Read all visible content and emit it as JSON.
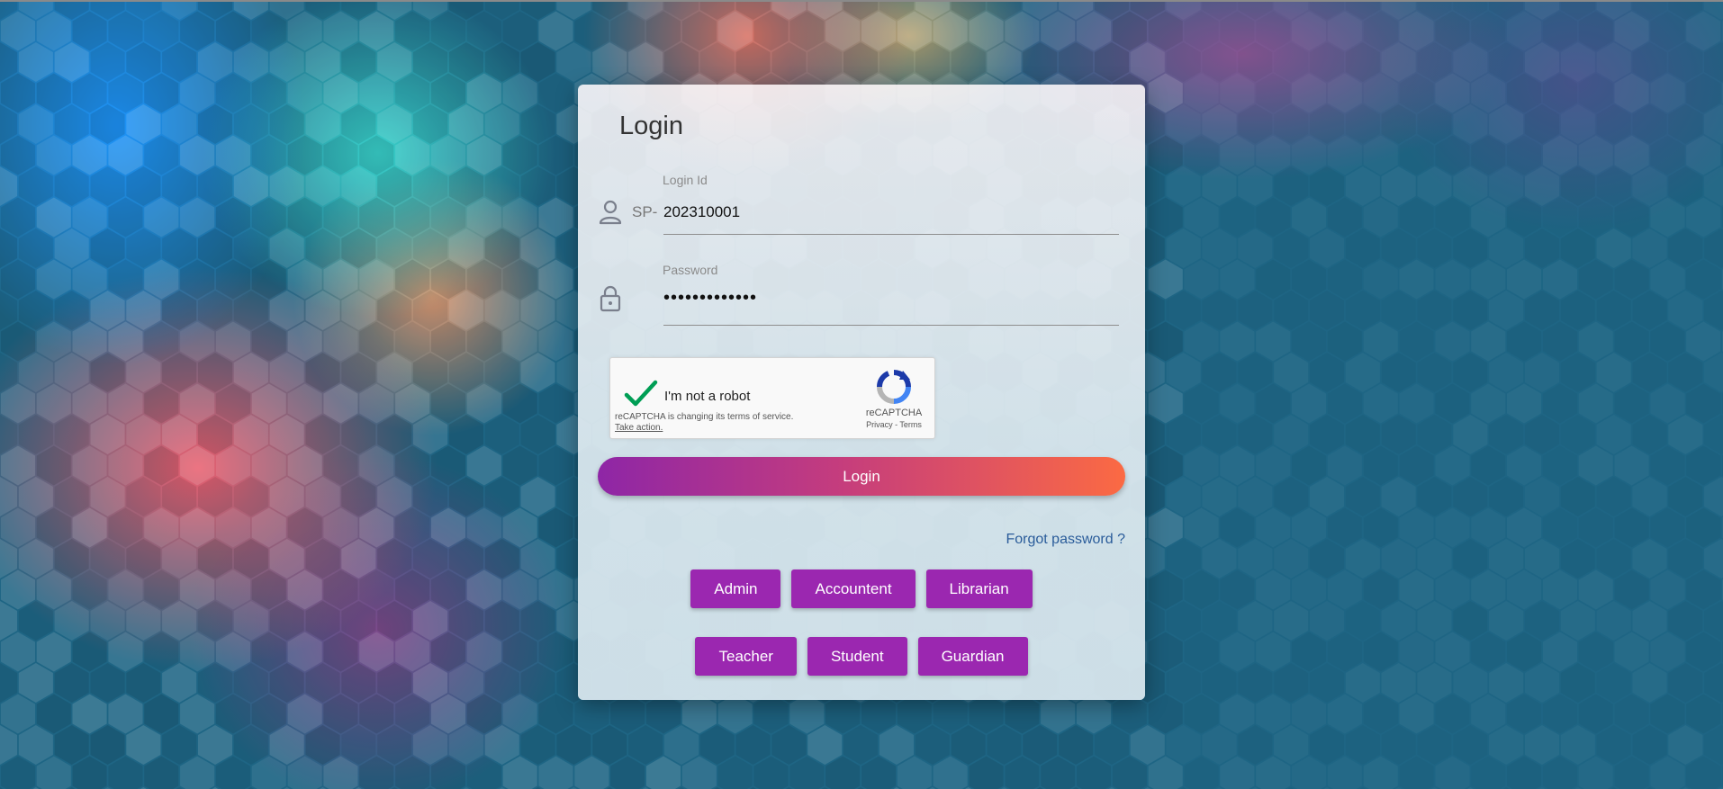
{
  "login_form": {
    "title": "Login",
    "login_id": {
      "label": "Login Id",
      "prefix": "SP-",
      "value": "202310001"
    },
    "password": {
      "label": "Password",
      "value": "•••••••••••••"
    },
    "recaptcha": {
      "checkbox_label": "I'm not a robot",
      "notice": "reCAPTCHA is changing its terms of service.",
      "notice_action": "Take action.",
      "brand": "reCAPTCHA",
      "links": "Privacy - Terms",
      "checked": true
    },
    "submit_label": "Login",
    "forgot_password": "Forgot password ?",
    "roles_row1": [
      "Admin",
      "Accountent",
      "Librarian"
    ],
    "roles_row2": [
      "Teacher",
      "Student",
      "Guardian"
    ]
  },
  "colors": {
    "background": "#1e6584",
    "role_button": "#9b27b0",
    "login_gradient_start": "#8e26a6",
    "login_gradient_end": "#fb6a43",
    "forgot_link": "#2a5c9a",
    "recaptcha_check": "#009e55"
  },
  "icons": {
    "login_id": "person-icon",
    "password": "lock-icon",
    "recaptcha_check": "check-icon",
    "recaptcha_logo": "recaptcha-logo-icon"
  }
}
